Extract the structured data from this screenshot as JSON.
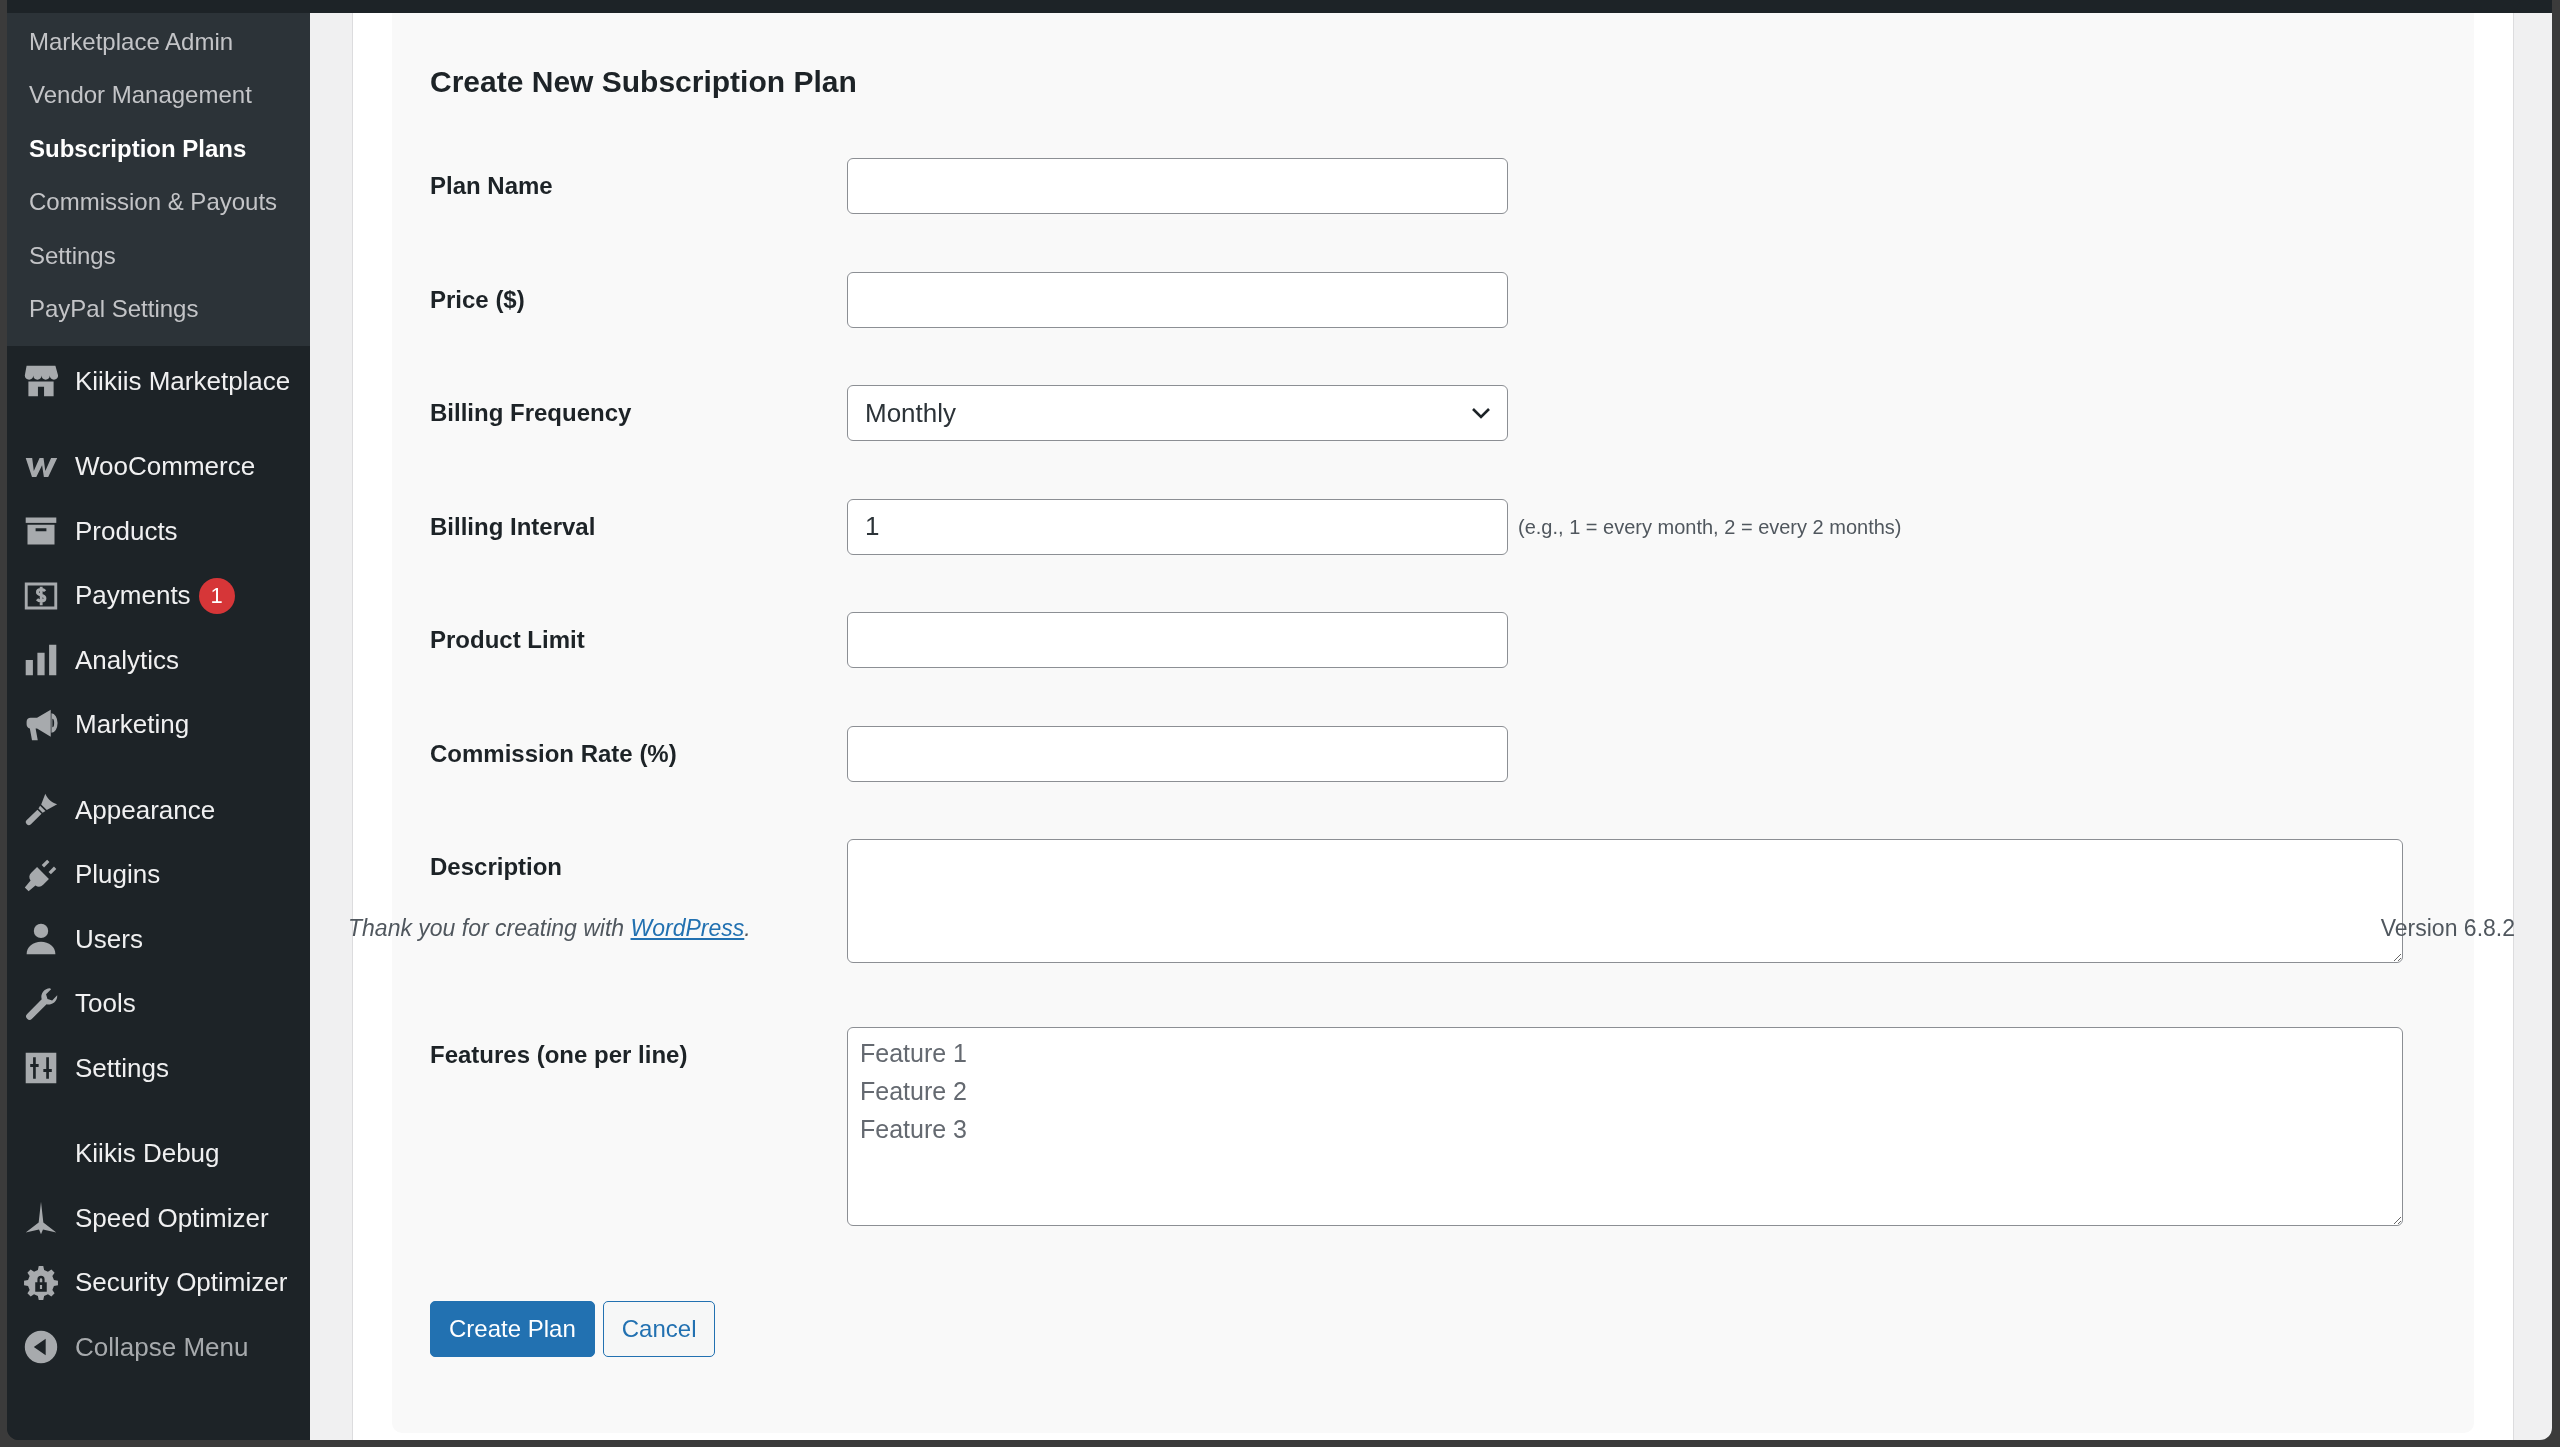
{
  "admin_menu": {
    "submenu": [
      {
        "label": "Marketplace Admin",
        "selected": false
      },
      {
        "label": "Vendor Management",
        "selected": false
      },
      {
        "label": "Subscription Plans",
        "selected": true
      },
      {
        "label": "Commission & Payouts",
        "selected": false
      },
      {
        "label": "Settings",
        "selected": false
      },
      {
        "label": "PayPal Settings",
        "selected": false
      }
    ],
    "groups": [
      {
        "items": [
          {
            "label": "Kiikiis Marketplace"
          }
        ]
      },
      {
        "items": [
          {
            "label": "WooCommerce"
          },
          {
            "label": "Products"
          },
          {
            "label": "Payments",
            "badge": "1"
          },
          {
            "label": "Analytics"
          },
          {
            "label": "Marketing"
          }
        ]
      },
      {
        "items": [
          {
            "label": "Appearance"
          },
          {
            "label": "Plugins"
          },
          {
            "label": "Users"
          },
          {
            "label": "Tools"
          },
          {
            "label": "Settings"
          }
        ]
      },
      {
        "items": [
          {
            "label": "Kiikis Debug"
          },
          {
            "label": "Speed Optimizer"
          },
          {
            "label": "Security Optimizer"
          }
        ]
      }
    ],
    "collapse_button": {
      "label": "Collapse Menu"
    }
  },
  "form": {
    "title": "Create New Subscription Plan",
    "fields": [
      {
        "kind": "text",
        "label": "Plan Name"
      },
      {
        "kind": "text",
        "label": "Price ($)"
      },
      {
        "kind": "select",
        "label": "Billing Frequency",
        "value": "Monthly"
      },
      {
        "kind": "text",
        "label": "Billing Interval",
        "value": "1",
        "hint": "(e.g., 1 = every month, 2 = every 2 months)"
      },
      {
        "kind": "text",
        "label": "Product Limit"
      },
      {
        "kind": "text",
        "label": "Commission Rate (%)"
      },
      {
        "kind": "textarea",
        "label": "Description"
      },
      {
        "kind": "textarea",
        "label": "Features (one per line)",
        "placeholder": "Feature 1\nFeature 2\nFeature 3"
      }
    ],
    "buttons": [
      {
        "kind": "primary",
        "label": "Create Plan"
      },
      {
        "kind": "secondary",
        "label": "Cancel"
      }
    ]
  },
  "footer": {
    "thanks_text": "Thank you for creating with ",
    "thanks_link": "WordPress",
    "thanks_end": ".",
    "version": "Version 6.8.2"
  }
}
